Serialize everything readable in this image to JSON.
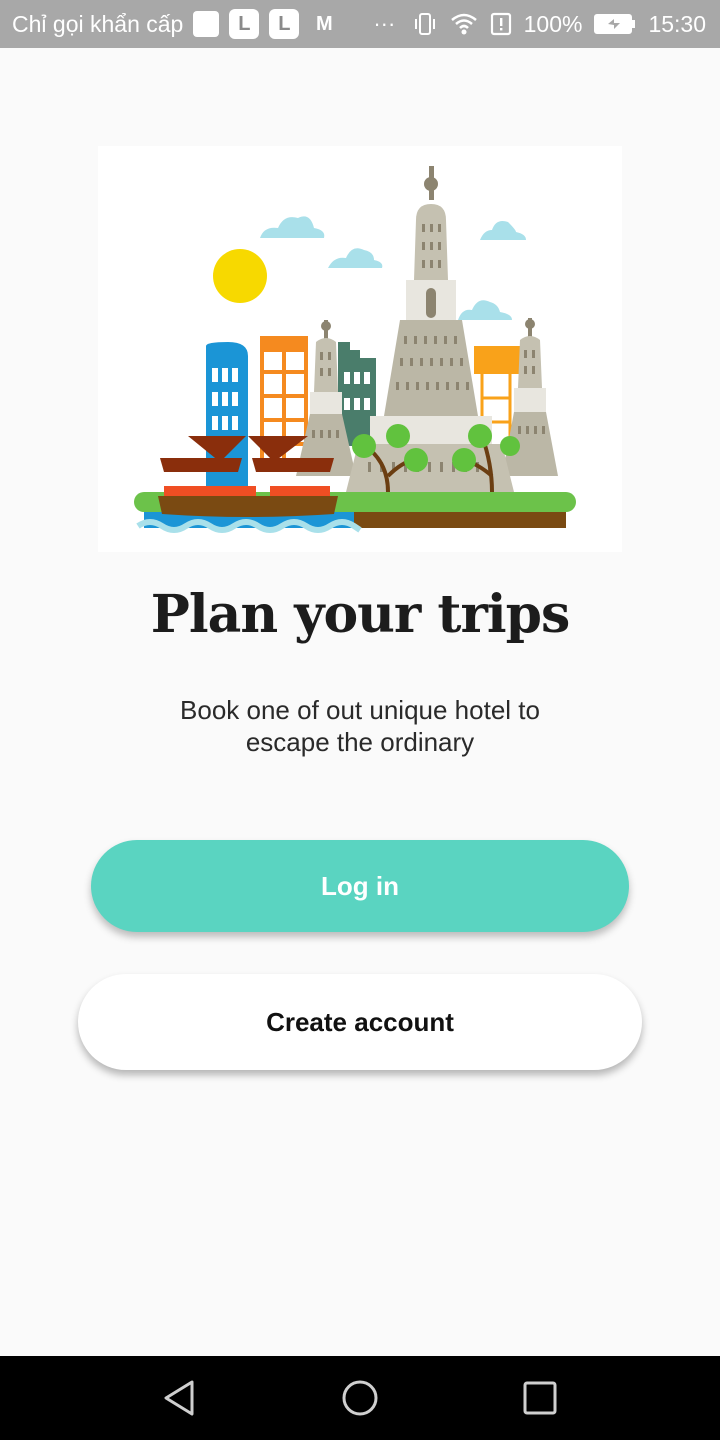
{
  "status_bar": {
    "carrier": "Chỉ gọi khẩn cấp",
    "app_icons": [
      "L",
      "L",
      "M"
    ],
    "overflow": "···",
    "battery": "100%",
    "time": "15:30",
    "icons": [
      "vibrate-icon",
      "wifi-icon",
      "alert-icon",
      "battery-icon"
    ]
  },
  "onboarding": {
    "title": "Plan your trips",
    "subtitle": "Book one of out unique hotel to escape the ordinary"
  },
  "buttons": {
    "login": "Log in",
    "create_account": "Create account"
  },
  "colors": {
    "accent": "#5ad4c1",
    "status_bar": "#a8a8a8",
    "nav_bar": "#000000"
  },
  "nav_bar": {
    "icons": [
      "back-icon",
      "home-icon",
      "recents-icon"
    ]
  }
}
